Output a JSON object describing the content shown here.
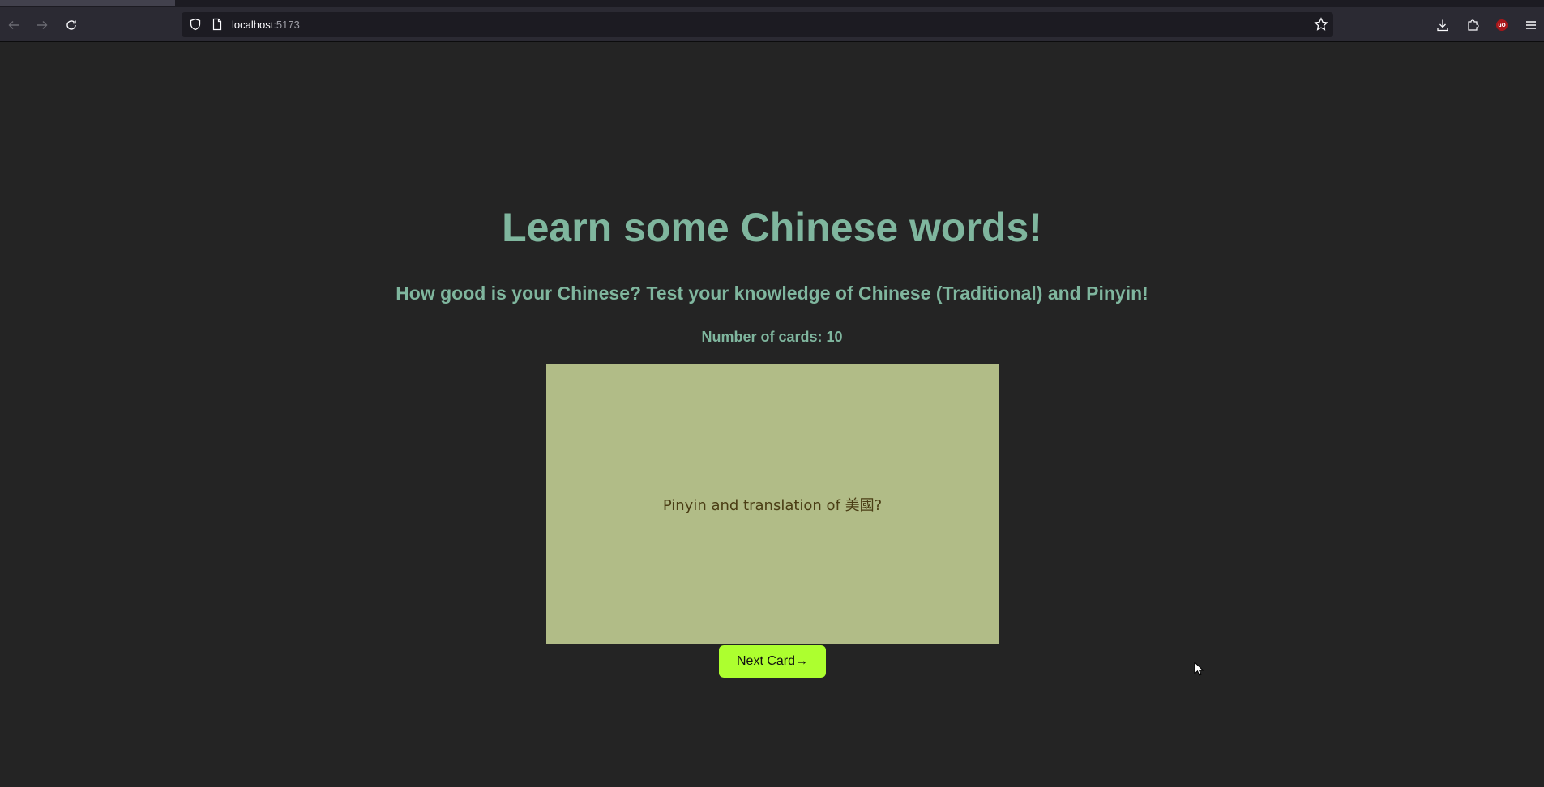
{
  "browser": {
    "url_host": "localhost",
    "url_port": ":5173",
    "icons": {
      "back": "arrow-left-icon",
      "forward": "arrow-right-icon",
      "reload": "reload-icon",
      "shield": "shield-icon",
      "page": "page-icon",
      "bookmark": "star-icon",
      "downloads": "download-icon",
      "extensions": "puzzle-icon",
      "ublock": "ublock-icon",
      "menu": "hamburger-menu-icon"
    },
    "ublock_badge": "uO"
  },
  "main": {
    "title": "Learn some Chinese words!",
    "subtitle": "How good is your Chinese? Test your knowledge of Chinese (Traditional) and Pinyin!",
    "card_count": "Number of cards: 10",
    "card": {
      "question": "Pinyin and translation of 美國?"
    },
    "next_button_label": "Next Card→"
  },
  "colors": {
    "background": "#242424",
    "heading": "#7fb69e",
    "card_bg": "#b1bc87",
    "card_text": "#4a3d14",
    "button_bg": "#adff2f"
  }
}
